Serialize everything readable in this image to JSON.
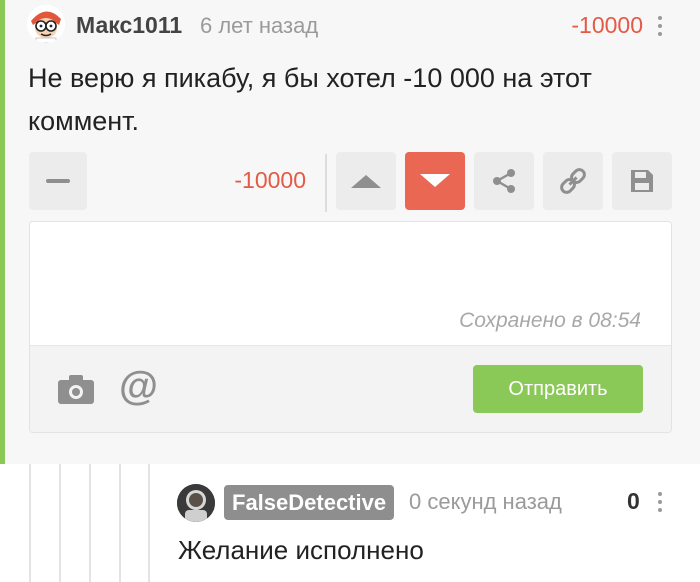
{
  "comment": {
    "author": "Макс1011",
    "time": "6 лет назад",
    "score": "-10000",
    "text": "Не верю я пикабу, я бы хотел -10 000 на этот коммент."
  },
  "vote_bar": {
    "score": "-10000",
    "icons": [
      "minus-icon",
      "arrow-up-icon",
      "arrow-down-icon",
      "share-icon",
      "link-icon",
      "save-icon"
    ]
  },
  "editor": {
    "saved_status": "Сохранено в 08:54",
    "send_label": "Отправить",
    "icons": [
      "camera-icon",
      "at-icon"
    ]
  },
  "reply": {
    "author": "FalseDetective",
    "time": "0 секунд назад",
    "score": "0",
    "text": "Желание исполнено"
  },
  "colors": {
    "accent_green": "#8ac858",
    "downvote_red": "#ea6753",
    "negative_score": "#e45a46"
  }
}
